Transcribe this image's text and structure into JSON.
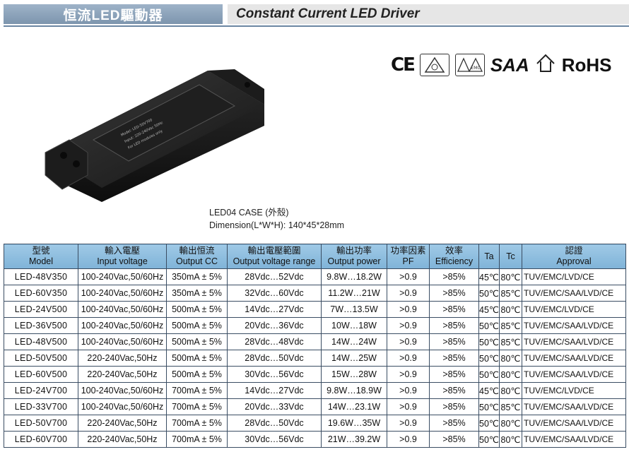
{
  "header": {
    "cn_title": "恒流LED驅動器",
    "en_title": "Constant Current LED Driver"
  },
  "certifications": [
    {
      "name": "CE",
      "icon": "ce-mark-icon"
    },
    {
      "name": "",
      "icon": "triangle-cert-icon"
    },
    {
      "name": "",
      "icon": "emc-cert-icon"
    },
    {
      "name": "SAA",
      "icon": "saa-mark-icon"
    },
    {
      "name": "",
      "icon": "house-mark-icon"
    },
    {
      "name": "RoHS",
      "icon": "rohs-mark-icon"
    }
  ],
  "product": {
    "label_text": "For LED modules only"
  },
  "case_info": {
    "case": "LED04  CASE (外殼)",
    "dimension": "Dimension(L*W*H): 140*45*28mm"
  },
  "table": {
    "headers": [
      {
        "cn": "型號",
        "en": "Model"
      },
      {
        "cn": "輸入電壓",
        "en": "Input voltage"
      },
      {
        "cn": "輸出恒流",
        "en": "Output CC"
      },
      {
        "cn": "輸出電壓範圍",
        "en": "Output voltage range"
      },
      {
        "cn": "輸出功率",
        "en": "Output power"
      },
      {
        "cn": "功率因素",
        "en": "PF"
      },
      {
        "cn": "效率",
        "en": "Efficiency"
      },
      {
        "cn": "",
        "en": "Ta"
      },
      {
        "cn": "",
        "en": "Tc"
      },
      {
        "cn": "認證",
        "en": "Approval"
      }
    ],
    "rows": [
      [
        "LED-48V350",
        "100-240Vac,50/60Hz",
        "350mA ± 5%",
        "28Vdc…52Vdc",
        "9.8W…18.2W",
        ">0.9",
        ">85%",
        "45℃",
        "80℃",
        "TUV/EMC/LVD/CE"
      ],
      [
        "LED-60V350",
        "100-240Vac,50/60Hz",
        "350mA ± 5%",
        "32Vdc…60Vdc",
        "11.2W…21W",
        ">0.9",
        ">85%",
        "50℃",
        "85℃",
        "TUV/EMC/SAA/LVD/CE"
      ],
      [
        "LED-24V500",
        "100-240Vac,50/60Hz",
        "500mA ± 5%",
        "14Vdc…27Vdc",
        "7W…13.5W",
        ">0.9",
        ">85%",
        "45℃",
        "80℃",
        "TUV/EMC/LVD/CE"
      ],
      [
        "LED-36V500",
        "100-240Vac,50/60Hz",
        "500mA ± 5%",
        "20Vdc…36Vdc",
        "10W…18W",
        ">0.9",
        ">85%",
        "50℃",
        "85℃",
        "TUV/EMC/SAA/LVD/CE"
      ],
      [
        "LED-48V500",
        "100-240Vac,50/60Hz",
        "500mA ± 5%",
        "28Vdc…48Vdc",
        "14W…24W",
        ">0.9",
        ">85%",
        "50℃",
        "85℃",
        "TUV/EMC/SAA/LVD/CE"
      ],
      [
        "LED-50V500",
        "220-240Vac,50Hz",
        "500mA ± 5%",
        "28Vdc…50Vdc",
        "14W…25W",
        ">0.9",
        ">85%",
        "50℃",
        "80℃",
        "TUV/EMC/SAA/LVD/CE"
      ],
      [
        "LED-60V500",
        "220-240Vac,50Hz",
        "500mA ± 5%",
        "30Vdc…56Vdc",
        "15W…28W",
        ">0.9",
        ">85%",
        "50℃",
        "80℃",
        "TUV/EMC/SAA/LVD/CE"
      ],
      [
        "LED-24V700",
        "100-240Vac,50/60Hz",
        "700mA ± 5%",
        "14Vdc…27Vdc",
        "9.8W…18.9W",
        ">0.9",
        ">85%",
        "45℃",
        "80℃",
        "TUV/EMC/LVD/CE"
      ],
      [
        "LED-33V700",
        "100-240Vac,50/60Hz",
        "700mA ± 5%",
        "20Vdc…33Vdc",
        "14W…23.1W",
        ">0.9",
        ">85%",
        "50℃",
        "85℃",
        "TUV/EMC/SAA/LVD/CE"
      ],
      [
        "LED-50V700",
        "220-240Vac,50Hz",
        "700mA ± 5%",
        "28Vdc…50Vdc",
        "19.6W…35W",
        ">0.9",
        ">85%",
        "50℃",
        "80℃",
        "TUV/EMC/SAA/LVD/CE"
      ],
      [
        "LED-60V700",
        "220-240Vac,50Hz",
        "700mA ± 5%",
        "30Vdc…56Vdc",
        "21W…39.2W",
        ">0.9",
        ">85%",
        "50℃",
        "80℃",
        "TUV/EMC/SAA/LVD/CE"
      ]
    ]
  },
  "colors": {
    "header_bar": "#8aa2bb",
    "table_header": "#8fbfe0",
    "border": "#3a4d63"
  }
}
